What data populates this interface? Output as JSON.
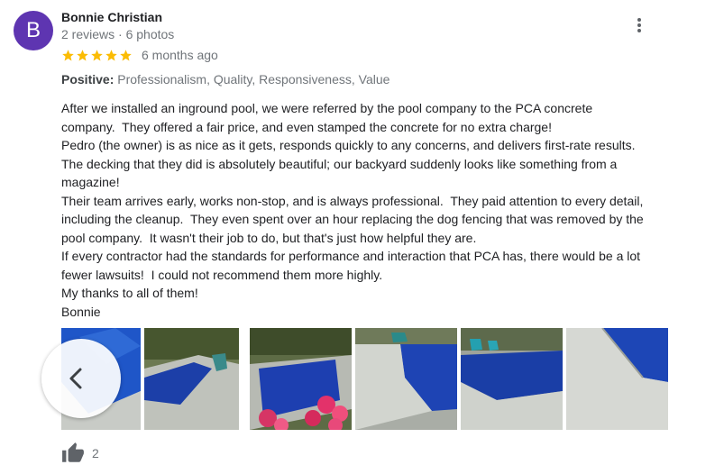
{
  "reviewer": {
    "initial": "B",
    "name": "Bonnie Christian",
    "meta": "2 reviews · 6 photos",
    "avatar_color": "#5e35b1"
  },
  "rating": {
    "stars": 5,
    "star_color": "#fbbc04",
    "time_ago": "6 months ago"
  },
  "positive": {
    "label": "Positive:",
    "values": "Professionalism, Quality, Responsiveness, Value"
  },
  "review_lines": [
    "After we installed an inground pool, we were referred by the pool company to the PCA concrete",
    "company.  They offered a fair price, and even stamped the concrete for no extra charge!",
    "Pedro (the owner) is as nice as it gets, responds quickly to any concerns, and delivers first-rate results.",
    "The decking that they did is absolutely beautiful; our backyard suddenly looks like something from a",
    "magazine!",
    "Their team arrives early, works non-stop, and is always professional.  They paid attention to every detail,",
    "including the cleanup.  They even spent over an hour replacing the dog fencing that was removed by the",
    "pool company.  It wasn't their job to do, but that's just how helpful they are.",
    "If every contractor had the standards for performance and interaction that PCA has, there would be a lot",
    "fewer lawsuits!  I could not recommend them more highly.",
    "My thanks to all of them!",
    "Bonnie"
  ],
  "photos": [
    {
      "icon": "pool-photo-1"
    },
    {
      "icon": "pool-photo-2"
    },
    {
      "icon": "pool-photo-3"
    },
    {
      "icon": "pool-photo-4"
    },
    {
      "icon": "pool-photo-5"
    },
    {
      "icon": "pool-photo-6"
    }
  ],
  "controls": {
    "prev_icon": "chevron-left-icon",
    "more_icon": "more-vert-icon",
    "like_icon": "thumbs-up-icon"
  },
  "likes": {
    "count": "2"
  }
}
